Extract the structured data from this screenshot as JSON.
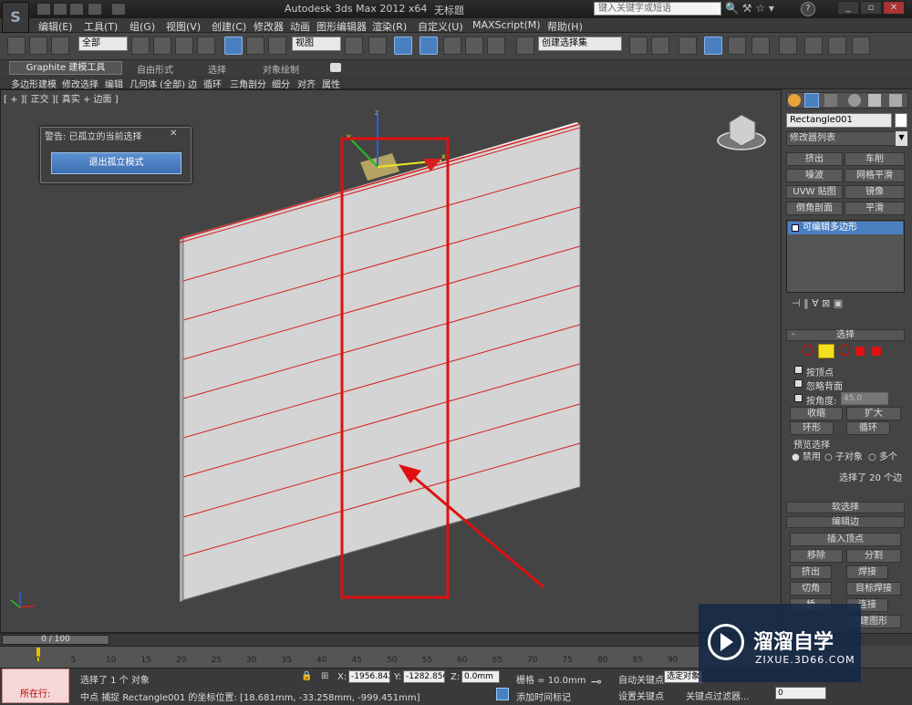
{
  "window": {
    "app_title": "Autodesk 3ds Max  2012 x64",
    "doc_title": "无标题",
    "search_placeholder": "键入关键字或短语"
  },
  "menubar": [
    "编辑(E)",
    "工具(T)",
    "组(G)",
    "视图(V)",
    "创建(C)",
    "修改器",
    "动画",
    "图形编辑器",
    "渲染(R)",
    "自定义(U)",
    "MAXScript(M)",
    "帮助(H)"
  ],
  "toolbar": {
    "selection_filter": "全部",
    "ref_coord": "视图",
    "named_selection": "创建选择集"
  },
  "ribbon": {
    "tabs": [
      "Graphite 建模工具",
      "自由形式",
      "选择",
      "对象绘制"
    ],
    "subtabs": [
      "多边形建模",
      "修改选择",
      "编辑",
      "几何体 (全部)",
      "边",
      "循环",
      "三角剖分",
      "细分",
      "对齐",
      "属性"
    ]
  },
  "viewport": {
    "label": "[ + ][ 正交 ][ 真实 + 边面 ]"
  },
  "dialog": {
    "title": "警告: 已孤立的当前选择",
    "button": "退出孤立模式"
  },
  "command_panel": {
    "object_name": "Rectangle001",
    "modifier_list": "修改器列表",
    "modifier_buttons": [
      "挤出",
      "车削",
      "噪波",
      "网格平滑",
      "UVW 贴图",
      "镜像",
      "倒角剖面",
      "平滑"
    ],
    "stack_item": "可编辑多边形",
    "selection_rollout": "选择",
    "by_vertex": "按顶点",
    "ignore_backface": "忽略背面",
    "by_angle": "按角度:",
    "angle_value": "45.0",
    "shrink": "收缩",
    "grow": "扩大",
    "ring": "环形",
    "loop": "循环",
    "preview_label": "预览选择",
    "preview_options": [
      "禁用",
      "子对象",
      "多个"
    ],
    "selected_count": "选择了 20 个边",
    "soft_selection": "软选择",
    "edit_edges": "编辑边",
    "insert_vertex": "插入顶点",
    "edge_buttons": [
      "移除",
      "分割",
      "挤出",
      "焊接",
      "切角",
      "目标焊接",
      "桥",
      "连接"
    ],
    "create_shape": "建图形"
  },
  "timeline": {
    "frame": "0 / 100",
    "ticks": [
      "0",
      "5",
      "10",
      "15",
      "20",
      "25",
      "30",
      "35",
      "40",
      "45",
      "50",
      "55",
      "60",
      "65",
      "70",
      "75",
      "80",
      "85",
      "90"
    ]
  },
  "status": {
    "running": "所在行:",
    "selected": "选择了 1 个 对象",
    "prompt": "中点 捕捉 Rectangle001 的坐标位置:  [18.681mm, -33.258mm, -999.451mm]",
    "x_label": "X:",
    "x_value": "-1956.842r",
    "y_label": "Y:",
    "y_value": "-1282.856r",
    "z_label": "Z:",
    "z_value": "0.0mm",
    "grid": "栅格 = 10.0mm",
    "add_time_tag": "添加时间标记",
    "auto_key": "自动关键点",
    "set_key": "设置关键点",
    "selected_object": "选定对象",
    "key_filters": "关键点过滤器...",
    "frame_value": "0"
  },
  "watermark": {
    "brand": "溜溜自学",
    "url": "ZIXUE.3D66.COM"
  },
  "colors": {
    "accent_blue": "#4a7fc0",
    "annotation_red": "#e01010",
    "edge_red": "#d42020",
    "panel_face": "#d4d4d4"
  }
}
